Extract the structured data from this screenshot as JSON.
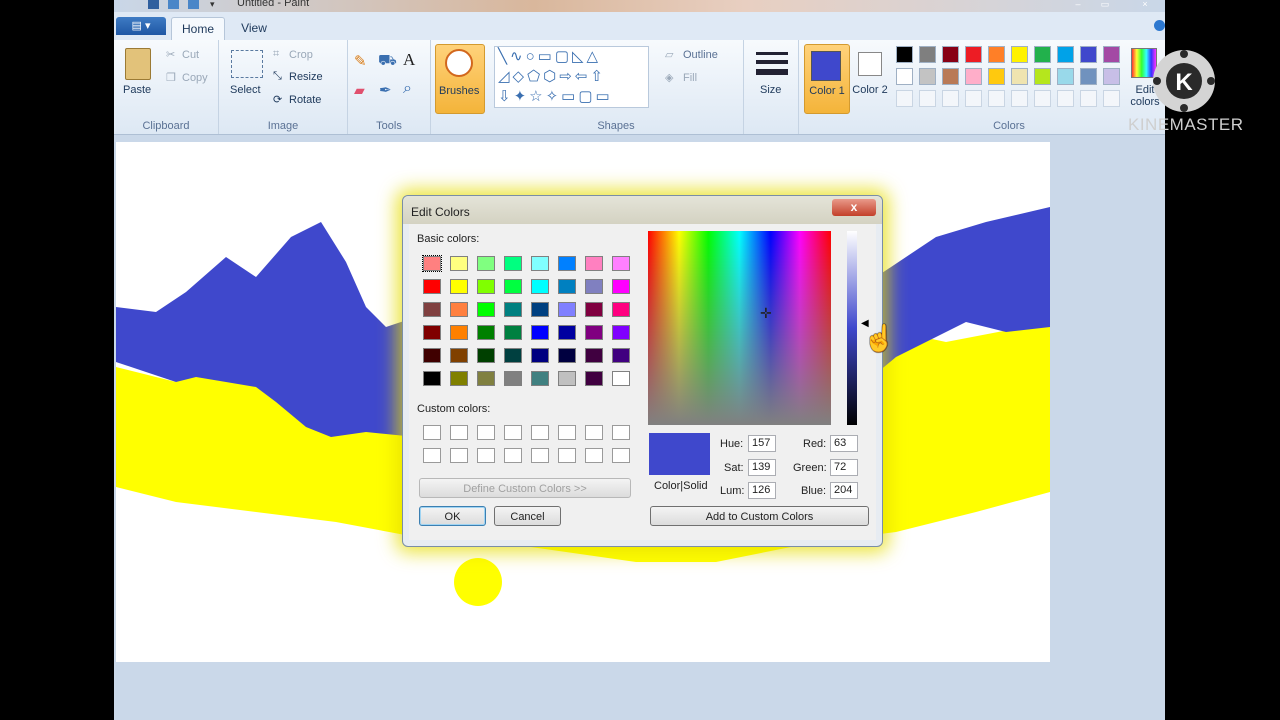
{
  "window": {
    "title": "Untitled - Paint"
  },
  "tabs": {
    "file": "▤ ▾",
    "home": "Home",
    "view": "View"
  },
  "clipboard": {
    "paste": "Paste",
    "cut": "Cut",
    "copy": "Copy",
    "label": "Clipboard"
  },
  "image": {
    "select": "Select",
    "crop": "Crop",
    "resize": "Resize",
    "rotate": "Rotate",
    "label": "Image"
  },
  "tools": {
    "label": "Tools"
  },
  "brushes": {
    "label": "Brushes"
  },
  "shapes": {
    "outline": "Outline",
    "fill": "Fill",
    "label": "Shapes"
  },
  "size": {
    "label": "Size"
  },
  "colors": {
    "color1": "Color 1",
    "color2": "Color 2",
    "edit": "Edit colors",
    "label": "Colors",
    "color1_value": "#3f48cc",
    "color2_value": "#ffffff",
    "palette_row1": [
      "#000000",
      "#7f7f7f",
      "#880015",
      "#ed1c24",
      "#ff7f27",
      "#fff200",
      "#22b14c",
      "#00a2e8",
      "#3f48cc",
      "#a349a4"
    ],
    "palette_row2": [
      "#ffffff",
      "#c3c3c3",
      "#b97a57",
      "#ffaec9",
      "#ffc90e",
      "#efe4b0",
      "#b5e61d",
      "#99d9ea",
      "#7092be",
      "#c8bfe7"
    ]
  },
  "watermark": {
    "brand": "KINEMASTER",
    "logo_letter": "K"
  },
  "dialog": {
    "title": "Edit Colors",
    "close": "x",
    "basic_colors_label": "Basic colors:",
    "custom_colors_label": "Custom colors:",
    "define_custom": "Define Custom Colors >>",
    "ok": "OK",
    "cancel": "Cancel",
    "color_solid": "Color|Solid",
    "add_custom": "Add to Custom Colors",
    "hue_label": "Hue:",
    "hue": "157",
    "sat_label": "Sat:",
    "sat": "139",
    "lum_label": "Lum:",
    "lum": "126",
    "red_label": "Red:",
    "red": "63",
    "green_label": "Green:",
    "green": "72",
    "blue_label": "Blue:",
    "blue": "204",
    "basic_colors": [
      [
        "#ff8080",
        "#ffff80",
        "#80ff80",
        "#00ff80",
        "#80ffff",
        "#0080ff",
        "#ff80c0",
        "#ff80ff"
      ],
      [
        "#ff0000",
        "#ffff00",
        "#80ff00",
        "#00ff40",
        "#00ffff",
        "#0080c0",
        "#8080c0",
        "#ff00ff"
      ],
      [
        "#804040",
        "#ff8040",
        "#00ff00",
        "#008080",
        "#004080",
        "#8080ff",
        "#800040",
        "#ff0080"
      ],
      [
        "#800000",
        "#ff8000",
        "#008000",
        "#008040",
        "#0000ff",
        "#0000a0",
        "#800080",
        "#8000ff"
      ],
      [
        "#400000",
        "#804000",
        "#004000",
        "#004040",
        "#000080",
        "#000040",
        "#400040",
        "#400080"
      ],
      [
        "#000000",
        "#808000",
        "#808040",
        "#808080",
        "#408080",
        "#c0c0c0",
        "#400040",
        "#ffffff"
      ]
    ]
  }
}
